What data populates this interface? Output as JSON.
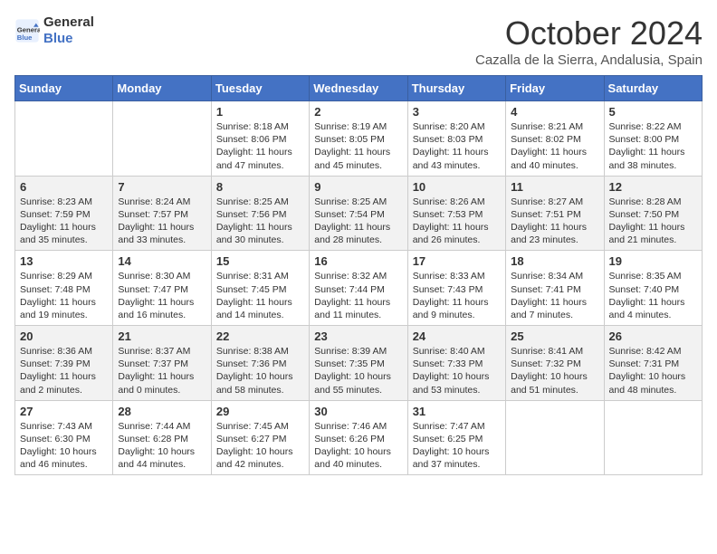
{
  "header": {
    "logo_line1": "General",
    "logo_line2": "Blue",
    "month": "October 2024",
    "location": "Cazalla de la Sierra, Andalusia, Spain"
  },
  "days_of_week": [
    "Sunday",
    "Monday",
    "Tuesday",
    "Wednesday",
    "Thursday",
    "Friday",
    "Saturday"
  ],
  "weeks": [
    [
      {
        "day": "",
        "content": ""
      },
      {
        "day": "",
        "content": ""
      },
      {
        "day": "1",
        "content": "Sunrise: 8:18 AM\nSunset: 8:06 PM\nDaylight: 11 hours and 47 minutes."
      },
      {
        "day": "2",
        "content": "Sunrise: 8:19 AM\nSunset: 8:05 PM\nDaylight: 11 hours and 45 minutes."
      },
      {
        "day": "3",
        "content": "Sunrise: 8:20 AM\nSunset: 8:03 PM\nDaylight: 11 hours and 43 minutes."
      },
      {
        "day": "4",
        "content": "Sunrise: 8:21 AM\nSunset: 8:02 PM\nDaylight: 11 hours and 40 minutes."
      },
      {
        "day": "5",
        "content": "Sunrise: 8:22 AM\nSunset: 8:00 PM\nDaylight: 11 hours and 38 minutes."
      }
    ],
    [
      {
        "day": "6",
        "content": "Sunrise: 8:23 AM\nSunset: 7:59 PM\nDaylight: 11 hours and 35 minutes."
      },
      {
        "day": "7",
        "content": "Sunrise: 8:24 AM\nSunset: 7:57 PM\nDaylight: 11 hours and 33 minutes."
      },
      {
        "day": "8",
        "content": "Sunrise: 8:25 AM\nSunset: 7:56 PM\nDaylight: 11 hours and 30 minutes."
      },
      {
        "day": "9",
        "content": "Sunrise: 8:25 AM\nSunset: 7:54 PM\nDaylight: 11 hours and 28 minutes."
      },
      {
        "day": "10",
        "content": "Sunrise: 8:26 AM\nSunset: 7:53 PM\nDaylight: 11 hours and 26 minutes."
      },
      {
        "day": "11",
        "content": "Sunrise: 8:27 AM\nSunset: 7:51 PM\nDaylight: 11 hours and 23 minutes."
      },
      {
        "day": "12",
        "content": "Sunrise: 8:28 AM\nSunset: 7:50 PM\nDaylight: 11 hours and 21 minutes."
      }
    ],
    [
      {
        "day": "13",
        "content": "Sunrise: 8:29 AM\nSunset: 7:48 PM\nDaylight: 11 hours and 19 minutes."
      },
      {
        "day": "14",
        "content": "Sunrise: 8:30 AM\nSunset: 7:47 PM\nDaylight: 11 hours and 16 minutes."
      },
      {
        "day": "15",
        "content": "Sunrise: 8:31 AM\nSunset: 7:45 PM\nDaylight: 11 hours and 14 minutes."
      },
      {
        "day": "16",
        "content": "Sunrise: 8:32 AM\nSunset: 7:44 PM\nDaylight: 11 hours and 11 minutes."
      },
      {
        "day": "17",
        "content": "Sunrise: 8:33 AM\nSunset: 7:43 PM\nDaylight: 11 hours and 9 minutes."
      },
      {
        "day": "18",
        "content": "Sunrise: 8:34 AM\nSunset: 7:41 PM\nDaylight: 11 hours and 7 minutes."
      },
      {
        "day": "19",
        "content": "Sunrise: 8:35 AM\nSunset: 7:40 PM\nDaylight: 11 hours and 4 minutes."
      }
    ],
    [
      {
        "day": "20",
        "content": "Sunrise: 8:36 AM\nSunset: 7:39 PM\nDaylight: 11 hours and 2 minutes."
      },
      {
        "day": "21",
        "content": "Sunrise: 8:37 AM\nSunset: 7:37 PM\nDaylight: 11 hours and 0 minutes."
      },
      {
        "day": "22",
        "content": "Sunrise: 8:38 AM\nSunset: 7:36 PM\nDaylight: 10 hours and 58 minutes."
      },
      {
        "day": "23",
        "content": "Sunrise: 8:39 AM\nSunset: 7:35 PM\nDaylight: 10 hours and 55 minutes."
      },
      {
        "day": "24",
        "content": "Sunrise: 8:40 AM\nSunset: 7:33 PM\nDaylight: 10 hours and 53 minutes."
      },
      {
        "day": "25",
        "content": "Sunrise: 8:41 AM\nSunset: 7:32 PM\nDaylight: 10 hours and 51 minutes."
      },
      {
        "day": "26",
        "content": "Sunrise: 8:42 AM\nSunset: 7:31 PM\nDaylight: 10 hours and 48 minutes."
      }
    ],
    [
      {
        "day": "27",
        "content": "Sunrise: 7:43 AM\nSunset: 6:30 PM\nDaylight: 10 hours and 46 minutes."
      },
      {
        "day": "28",
        "content": "Sunrise: 7:44 AM\nSunset: 6:28 PM\nDaylight: 10 hours and 44 minutes."
      },
      {
        "day": "29",
        "content": "Sunrise: 7:45 AM\nSunset: 6:27 PM\nDaylight: 10 hours and 42 minutes."
      },
      {
        "day": "30",
        "content": "Sunrise: 7:46 AM\nSunset: 6:26 PM\nDaylight: 10 hours and 40 minutes."
      },
      {
        "day": "31",
        "content": "Sunrise: 7:47 AM\nSunset: 6:25 PM\nDaylight: 10 hours and 37 minutes."
      },
      {
        "day": "",
        "content": ""
      },
      {
        "day": "",
        "content": ""
      }
    ]
  ]
}
